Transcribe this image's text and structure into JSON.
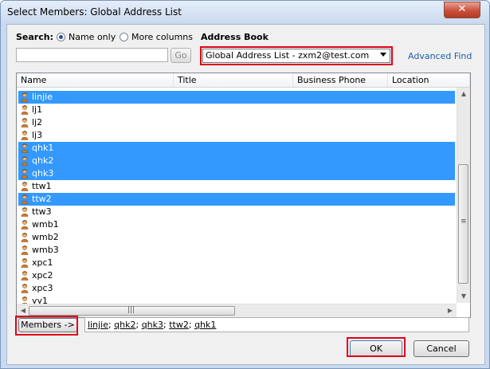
{
  "window": {
    "title": "Select Members: Global Address List",
    "close_label": "✕"
  },
  "search": {
    "label": "Search:",
    "name_only_label": "Name only",
    "more_columns_label": "More columns",
    "input_value": "",
    "go_label": "Go"
  },
  "address_book": {
    "label": "Address Book",
    "selected": "Global Address List - zxm2@test.com",
    "advanced_find_label": "Advanced Find"
  },
  "list": {
    "columns": [
      "Name",
      "Title",
      "Business Phone",
      "Location"
    ],
    "rows": [
      {
        "name": "linjie",
        "selected": true
      },
      {
        "name": "lj1",
        "selected": false
      },
      {
        "name": "lj2",
        "selected": false
      },
      {
        "name": "lj3",
        "selected": false
      },
      {
        "name": "qhk1",
        "selected": true
      },
      {
        "name": "qhk2",
        "selected": true
      },
      {
        "name": "qhk3",
        "selected": true
      },
      {
        "name": "ttw1",
        "selected": false
      },
      {
        "name": "ttw2",
        "selected": true
      },
      {
        "name": "ttw3",
        "selected": false
      },
      {
        "name": "wmb1",
        "selected": false
      },
      {
        "name": "wmb2",
        "selected": false
      },
      {
        "name": "wmb3",
        "selected": false
      },
      {
        "name": "xpc1",
        "selected": false
      },
      {
        "name": "xpc2",
        "selected": false
      },
      {
        "name": "xpc3",
        "selected": false
      },
      {
        "name": "yy1",
        "selected": false
      }
    ]
  },
  "members": {
    "button_label": "Members ->",
    "entries": [
      "linjie",
      "qhk2",
      "qhk3",
      "ttw2",
      "qhk1"
    ]
  },
  "footer": {
    "ok_label": "OK",
    "cancel_label": "Cancel"
  },
  "colors": {
    "selection": "#3399ff",
    "highlight_box": "#e0001a",
    "link": "#1f5faa"
  }
}
